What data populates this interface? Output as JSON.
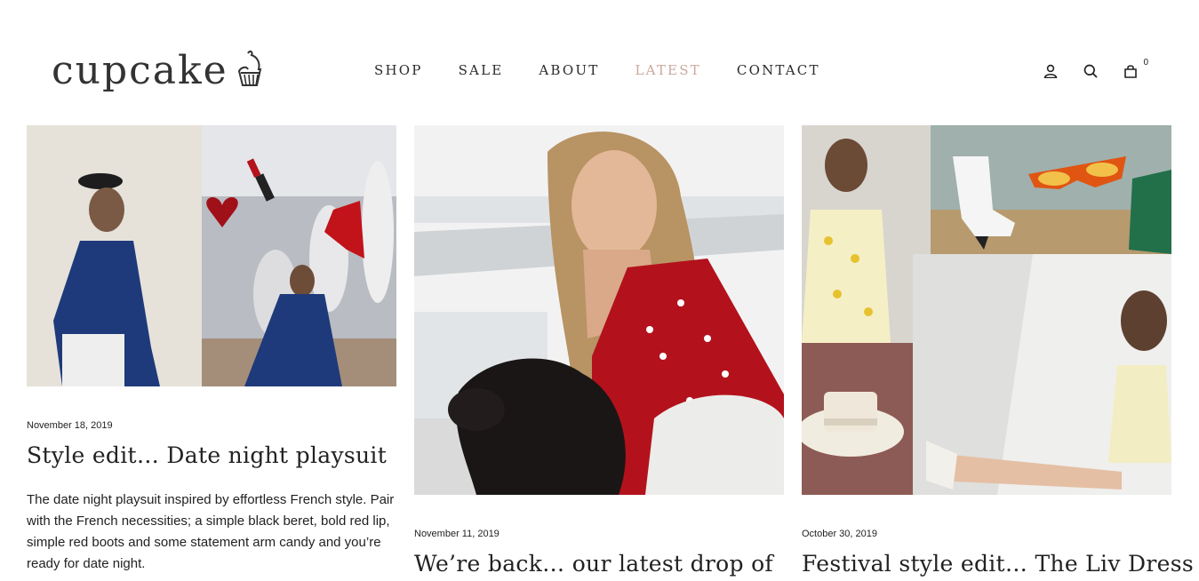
{
  "logo": {
    "text": "cupcake",
    "mark_icon": "cupcake-icon"
  },
  "nav": {
    "items": [
      {
        "label": "SHOP"
      },
      {
        "label": "SALE"
      },
      {
        "label": "ABOUT"
      },
      {
        "label": "LATEST",
        "active": true
      },
      {
        "label": "CONTACT"
      }
    ],
    "active_color": "#c8a99c"
  },
  "header_icons": {
    "account": "user-icon",
    "search": "search-icon",
    "cart": "bag-icon",
    "cart_count": "0"
  },
  "posts": [
    {
      "date": "November 18, 2019",
      "title": "Style edit… Date night playsuit",
      "excerpt": "The date night playsuit inspired by effortless French style. Pair with the French necessities; a simple black beret, bold red lip, simple red boots and some statement arm candy and you’re ready for date night."
    },
    {
      "date": "November 11, 2019",
      "title": "We’re back… our latest drop of"
    },
    {
      "date": "October 30, 2019",
      "title": "Festival style edit… The Liv Dress"
    }
  ]
}
